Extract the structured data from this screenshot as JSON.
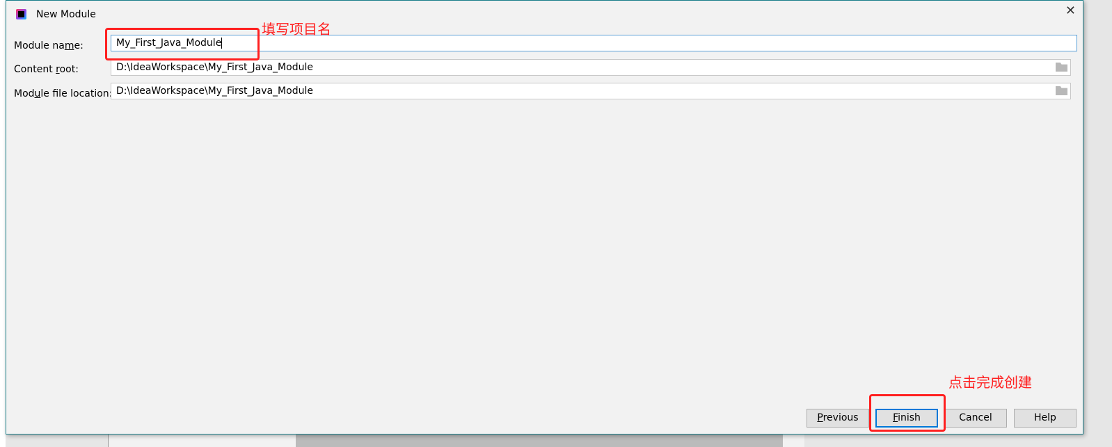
{
  "dialog": {
    "title": "New Module",
    "icon": "intellij-idea-icon"
  },
  "form": {
    "module_name": {
      "label_pre": "Module na",
      "label_mn": "m",
      "label_post": "e:",
      "value": "My_First_Java_Module"
    },
    "content_root": {
      "label_pre": "Content ",
      "label_mn": "r",
      "label_post": "oot:",
      "value": "D:\\IdeaWorkspace\\My_First_Java_Module"
    },
    "module_file": {
      "label_pre": "Mod",
      "label_mn": "u",
      "label_post": "le file location:",
      "value": "D:\\IdeaWorkspace\\My_First_Java_Module"
    }
  },
  "buttons": {
    "previous": {
      "mn": "P",
      "rest": "revious"
    },
    "finish": {
      "mn": "F",
      "rest": "inish"
    },
    "cancel": "Cancel",
    "help": "Help"
  },
  "annotations": {
    "name_hint": "填写项目名",
    "finish_hint": "点击完成创建",
    "color": "#ff2020"
  }
}
